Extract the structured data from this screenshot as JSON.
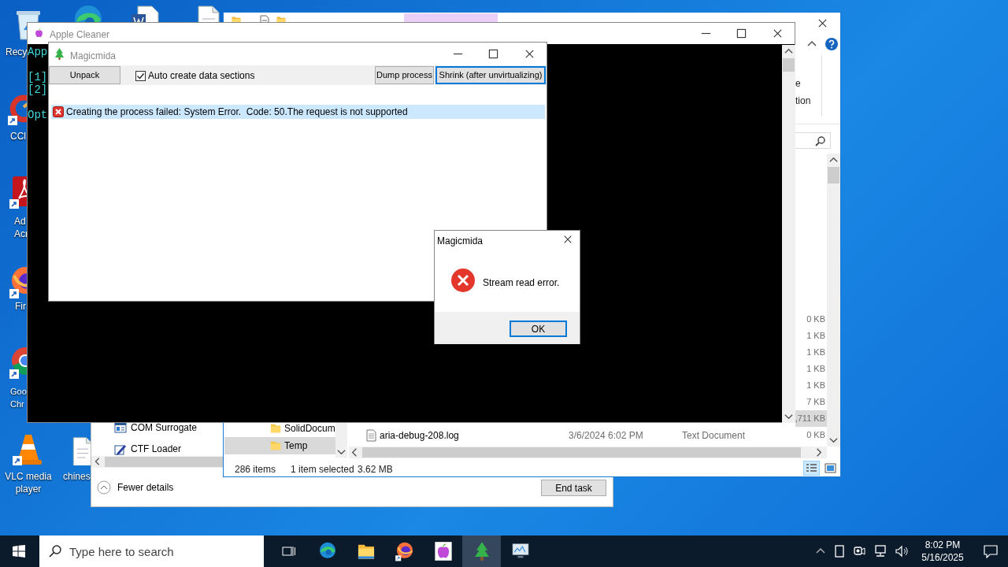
{
  "desktop_icons": [
    {
      "kind": "recycle-bin",
      "lines": [
        "Recy"
      ]
    },
    {
      "kind": "ccleaner",
      "lines": [
        "CCl"
      ]
    },
    {
      "kind": "acrobat",
      "lines": [
        "Ad",
        "Acr"
      ]
    },
    {
      "kind": "firefox",
      "lines": [
        "Fir"
      ]
    },
    {
      "kind": "chrome",
      "lines": [
        "Goo",
        "Chr"
      ]
    },
    {
      "kind": "vlc",
      "lines": [
        "VLC media",
        "player"
      ]
    },
    {
      "kind": "document",
      "lines": [
        "chines"
      ]
    },
    {
      "kind": "edge"
    },
    {
      "kind": "word-document"
    },
    {
      "kind": "document"
    }
  ],
  "task_manager": {
    "processes": [
      {
        "name": "COM Surrogate",
        "kind": "com"
      },
      {
        "name": "CTF Loader",
        "kind": "ctf"
      }
    ],
    "details_toggle": "Fewer details",
    "end_task_button": "End task"
  },
  "file_explorer": {
    "ribbon_fragments": [
      "e",
      "tion"
    ],
    "rows": [
      {
        "size": "0 KB",
        "selected": false
      },
      {
        "size": "1 KB",
        "selected": false
      },
      {
        "size": "1 KB",
        "selected": false
      },
      {
        "size": "1 KB",
        "selected": false
      },
      {
        "size": "1 KB",
        "selected": false
      },
      {
        "size": "7 KB",
        "selected": false
      },
      {
        "size": ",711 KB",
        "selected": true
      },
      {
        "name": "aria-debug-208.log",
        "date": "3/6/2024 6:02 PM",
        "type": "Text Document",
        "size": "0 KB",
        "selected": false
      }
    ],
    "tree": [
      {
        "label": "SolidDocum",
        "selected": false
      },
      {
        "label": "Temp",
        "selected": true
      }
    ],
    "status": {
      "item_count": "286 items",
      "selection": "1 item selected",
      "selection_size": "3.62 MB"
    },
    "views": [
      {
        "kind": "details",
        "selected": true
      },
      {
        "kind": "large-icons",
        "selected": false
      }
    ]
  },
  "console_window": {
    "title": "Apple Cleaner",
    "lines": [
      "App",
      "[1]",
      "[2]",
      "Opt"
    ]
  },
  "magicmida_window": {
    "title": "Magicmida",
    "toolbar": [
      {
        "kind": "button",
        "label": "Unpack",
        "focused": false
      },
      {
        "kind": "checkbox",
        "label": "Auto create data sections",
        "checked": true
      },
      {
        "kind": "button",
        "label": "Dump process",
        "focused": false
      },
      {
        "kind": "button",
        "label": "Shrink (after unvirtualizing)",
        "focused": true
      }
    ],
    "log": [
      {
        "kind": "error",
        "text": "Creating the process failed: System Error.  Code: 50.The request is not supported",
        "selected": true
      }
    ]
  },
  "message_box": {
    "title": "Magicmida",
    "kind": "error",
    "message": "Stream read error.",
    "button": "OK"
  },
  "taskbar": {
    "search_placeholder": "Type here to search",
    "apps": [
      {
        "kind": "edge",
        "active": false
      },
      {
        "kind": "folder",
        "active": false
      },
      {
        "kind": "firefox",
        "active": false
      },
      {
        "kind": "apple",
        "active": false
      },
      {
        "kind": "tree",
        "active": true
      },
      {
        "kind": "monitor",
        "active": false
      }
    ],
    "time": "8:02 PM",
    "date": "5/16/2025"
  }
}
